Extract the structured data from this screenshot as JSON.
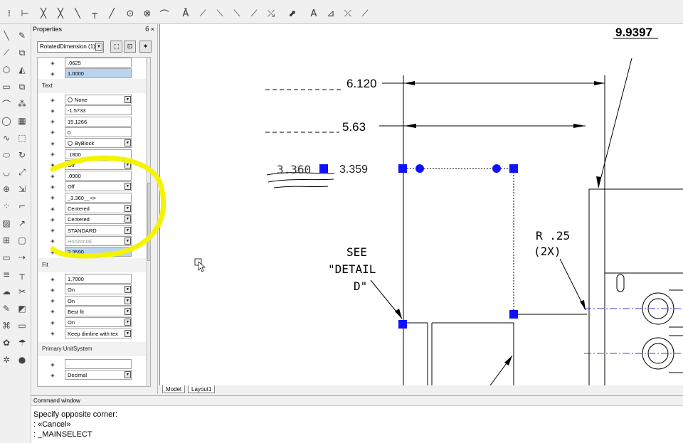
{
  "toolbar": {
    "icons": [
      "xline-icon",
      "dim-linear-icon",
      "dim-aligned-icon",
      "dim-ordinate-icon",
      "dim-radius-icon",
      "dim-diameter-icon",
      "dim-angular-icon",
      "dim-arc-icon",
      "dim-quick-icon",
      "dim-baseline-icon",
      "dim-continue-icon",
      "dim-tolerance-icon",
      "dim-center-icon",
      "dim-edit-icon",
      "dim-text-edit-icon",
      "dim-update-icon",
      "dim-style-icon",
      "dim-override-icon"
    ]
  },
  "properties": {
    "title": "Properties",
    "title_controls": "б ×",
    "object_type": "RotatedDimension (1)",
    "top_rows": [
      {
        "icon": "arrow-size-icon",
        "value": ".0625"
      },
      {
        "icon": "dim-line-icon",
        "value": "1.0000",
        "highlight": true
      }
    ],
    "text_section": "Text",
    "text_rows": [
      {
        "icon": "fill-color-icon",
        "value": "None",
        "swatch": true,
        "dropdown": true
      },
      {
        "icon": "text-x-icon",
        "value": "-1.5733"
      },
      {
        "icon": "text-y-icon",
        "value": "15.1266"
      },
      {
        "icon": "rotation-icon",
        "value": "0"
      },
      {
        "icon": "text-color-icon",
        "value": "ByBlock",
        "swatch": true,
        "dropdown": true
      },
      {
        "icon": "text-height-icon",
        "value": ".1800"
      },
      {
        "icon": "text-override-icon",
        "value": "Off",
        "dropdown": true
      },
      {
        "icon": "text-offset-icon",
        "value": ".0900"
      },
      {
        "icon": "text-fraction-icon",
        "value": "Off",
        "dropdown": true
      },
      {
        "icon": "text-override-value-icon",
        "value": "_3.360__<>"
      },
      {
        "icon": "text-pos-horiz-icon",
        "value": "Centered",
        "dropdown": true
      },
      {
        "icon": "text-pos-vert-icon",
        "value": "Centered",
        "dropdown": true
      },
      {
        "icon": "text-style-icon",
        "value": "STANDARD",
        "dropdown": true
      },
      {
        "icon": "text-inside-align-icon",
        "value": "Horizontal",
        "disabled": true,
        "dropdown": true
      },
      {
        "icon": "measurement-icon",
        "value": "3.3590",
        "highlight": true
      }
    ],
    "fit_section": "Fit",
    "fit_rows": [
      {
        "icon": "overall-scale-icon",
        "value": "1.7000"
      },
      {
        "icon": "dim-line-forced-icon",
        "value": "On",
        "dropdown": true
      },
      {
        "icon": "dim-line-inside-icon",
        "value": "On",
        "dropdown": true
      },
      {
        "icon": "fit-icon",
        "value": "Best fit",
        "dropdown": true
      },
      {
        "icon": "text-inside-icon",
        "value": "On",
        "dropdown": true
      },
      {
        "icon": "text-movement-icon",
        "value": "Keep dimline with tex",
        "dropdown": true
      }
    ],
    "unit_section": "Primary UnitSystem",
    "unit_rows": [
      {
        "icon": "decimal-sep-icon",
        "value": "."
      },
      {
        "icon": "unit-format-icon",
        "value": "Decimal",
        "dropdown": true
      }
    ]
  },
  "drawing": {
    "dim_top": "9.9397",
    "dim_6120": "6.120",
    "dim_563": "5.63",
    "dim_3360": "3.360",
    "dim_3359": "3.359",
    "note_r": "R .25",
    "note_2x": "(2X)",
    "see1": "SEE",
    "see2": "\"DETAIL",
    "see3": "D\"",
    "grip_color": "#1010ff"
  },
  "tabs": [
    "Model",
    "Layout1"
  ],
  "command": {
    "title": "Command window",
    "lines": [
      "Specify opposite corner:",
      ": «Cancel»",
      ": _MAINSELECT"
    ]
  }
}
